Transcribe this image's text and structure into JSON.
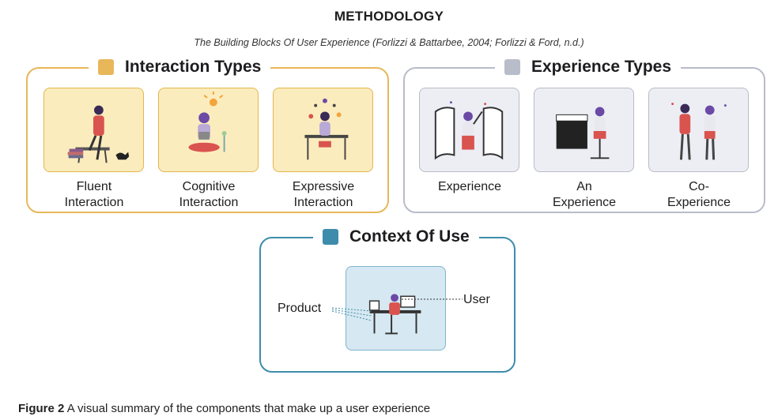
{
  "header": {
    "title": "METHODOLOGY",
    "subtitle": "The Building Blocks Of User Experience (Forlizzi & Battarbee, 2004; Forlizzi & Ford, n.d.)"
  },
  "groups": {
    "interaction": {
      "label": "Interaction Types",
      "color": "#e8b75a",
      "items": [
        {
          "line1": "Fluent",
          "line2": "Interaction"
        },
        {
          "line1": "Cognitive",
          "line2": "Interaction"
        },
        {
          "line1": "Expressive",
          "line2": "Interaction"
        }
      ]
    },
    "experience": {
      "label": "Experience Types",
      "color": "#b9bcc9",
      "items": [
        {
          "line1": "Experience",
          "line2": ""
        },
        {
          "line1": "An",
          "line2": "Experience"
        },
        {
          "line1": "Co-",
          "line2": "Experience"
        }
      ]
    },
    "context": {
      "label": "Context Of Use",
      "color": "#3d8cab",
      "product_label": "Product",
      "user_label": "User"
    }
  },
  "figure_caption": {
    "label": "Figure 2",
    "text": " A visual summary of the components that make up a user experience"
  }
}
